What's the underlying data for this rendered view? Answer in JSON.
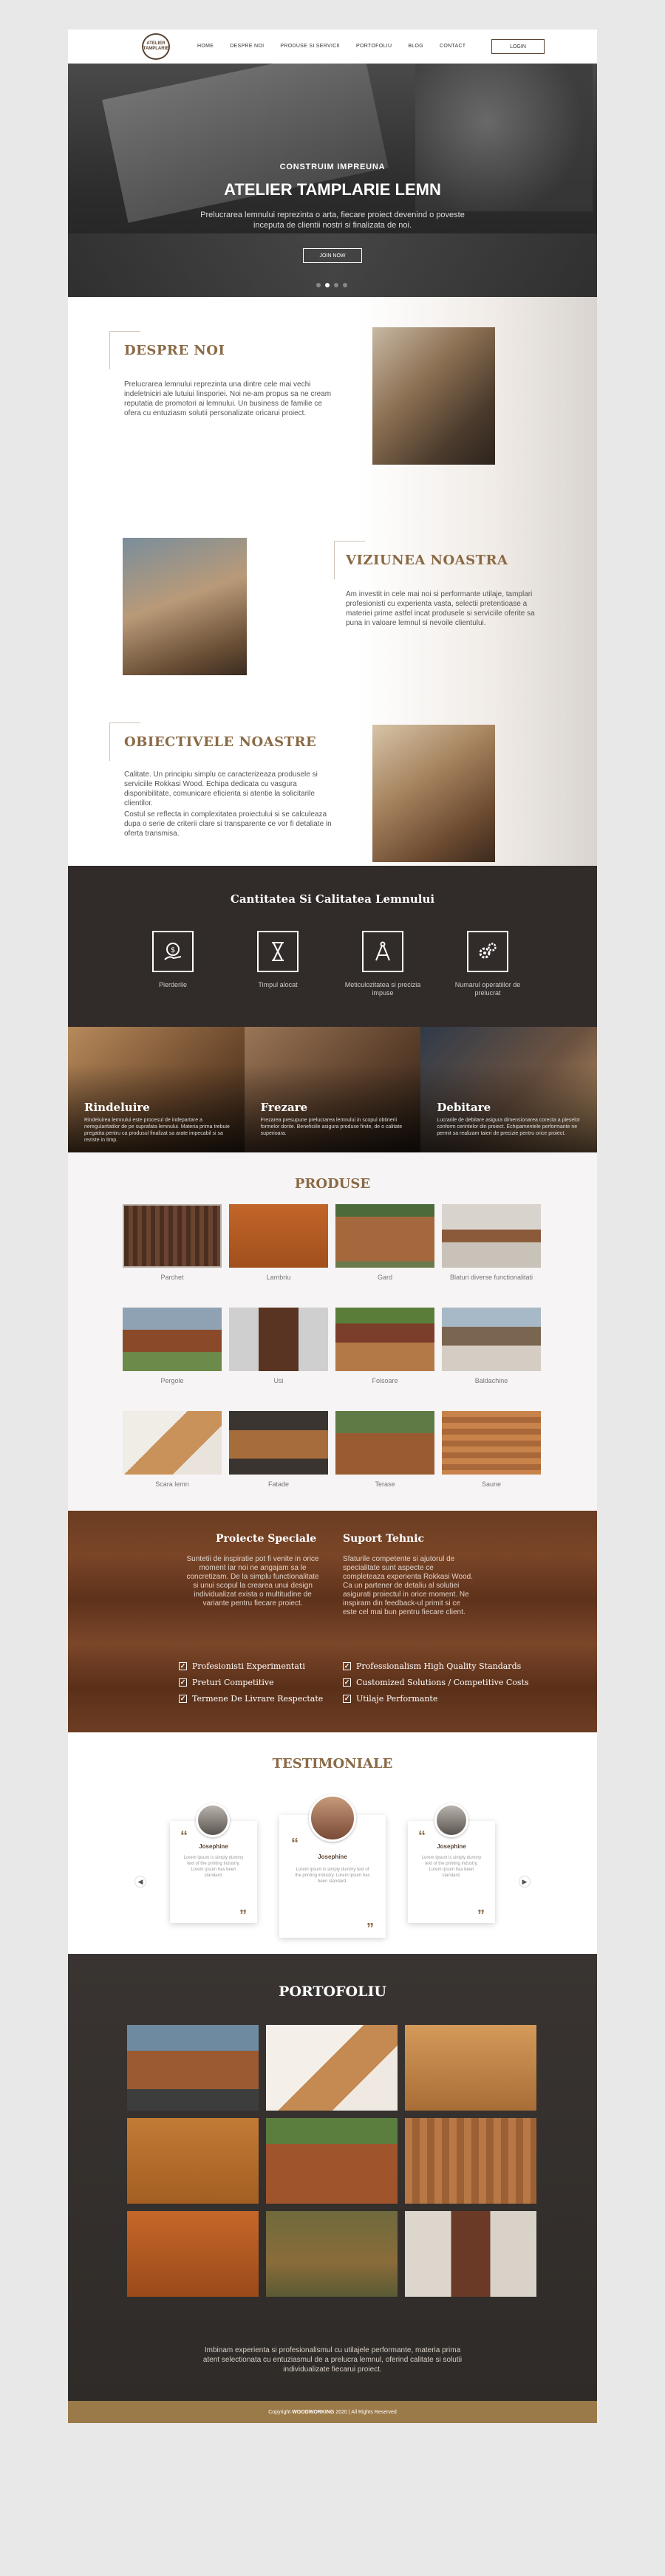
{
  "header": {
    "logo_text": "ATELIER TAMPLARIE",
    "nav": [
      "HOME",
      "DESPRE NOI",
      "PRODUSE SI SERVICII",
      "PORTOFOLIU",
      "BLOG",
      "CONTACT"
    ],
    "login_label": "LOGIN"
  },
  "hero": {
    "subtitle": "CONSTRUIM IMPREUNA",
    "title": "ATELIER TAMPLARIE LEMN",
    "description": "Prelucrarea lemnului reprezinta o arta, fiecare proiect devenind o poveste inceputa de clientii nostri si finalizata de noi.",
    "button_label": "JOIN NOW"
  },
  "about": {
    "despre_title": "DESPRE NOI",
    "despre_text": "Prelucrarea lemnului reprezinta una dintre cele mai vechi indeletniciri ale lutuiui linsporiei. Noi ne-am propus sa ne cream reputatia de promotori ai lemnului. Un business de familie ce ofera cu entuziasm solutii personalizate oricarui proiect.",
    "viziunea_title": "VIZIUNEA NOASTRA",
    "viziunea_text": "Am investit in cele mai noi si performante utilaje, tamplari profesionisti cu experienta vasta, selectii pretentioase a materiei prime astfel incat produsele si serviciile oferite sa puna in valoare lemnul si nevoile clientului.",
    "obiectivele_title": "OBIECTIVELE NOASTRE",
    "obiectivele_text1": "Calitate. Un principiu simplu ce caracterizeaza produsele si serviciile Rokkasi Wood. Echipa dedicata cu vasgura disponibilitate, comunicare eficienta si atentie la solicitarile clientilor.",
    "obiectivele_text2": "Costul se reflecta in complexitatea proiectului si se calculeaza dupa o serie de criterii clare si transparente ce vor fi detaliate in oferta transmisa."
  },
  "quality": {
    "title": "Cantitatea Si Calitatea Lemnului",
    "items": [
      {
        "icon": "money-icon",
        "label": "Pierderile"
      },
      {
        "icon": "hourglass-icon",
        "label": "Timpul alocat"
      },
      {
        "icon": "compass-icon",
        "label": "Meticulozitatea si precizia impuse"
      },
      {
        "icon": "gears-icon",
        "label": "Numarul operatiilor de prelucrat"
      }
    ]
  },
  "services": [
    {
      "title": "Rindeluire",
      "text": "Rindeluirea lemnului este procesul de indepartare a neregularitatilor de pe suprafata lemnului. Materia prima trebuie pregatita pentru ca produsul finalizat sa arate impecabil si sa reziste in timp."
    },
    {
      "title": "Frezare",
      "text": "Frezarea presupune prelucrarea lemnului in scopul obtinerii formelor dorite. Beneficiile asigura produse finite, de o calitate superioara."
    },
    {
      "title": "Debitare",
      "text": "Lucrarile de debitare asigura dimensionarea corecta a pieselor conform cerintelor din proiect. Echipamentele performante ne permit sa realizam taieri de precizie pentru orice proiect."
    }
  ],
  "products": {
    "title": "PRODUSE",
    "items": [
      "Parchet",
      "Lambriu",
      "Gard",
      "Blaturi diverse functionalitati",
      "Pergole",
      "Usi",
      "Foisoare",
      "Baldachine",
      "Scara lemn",
      "Fatade",
      "Terase",
      "Saune"
    ]
  },
  "features": {
    "proiecte_title": "Proiecte Speciale",
    "proiecte_text": "Suntetii de inspiratie pot fi venite in orice moment iar noi ne angajam sa le concretizam. De la simplu functionalitate si unui scopul la crearea unui design individualizat exista o multitudine de variante pentru fiecare proiect.",
    "suport_title": "Suport Tehnic",
    "suport_text": "Sfaturile competente si ajutorul de specialitate sunt aspecte ce completeaza experienta Rokkasi Wood. Ca un partener de detaliu al solutiei asigurati proiectul in orice moment. Ne inspiram din feedback-ul primit si ce este cel mai bun pentru fiecare client.",
    "checks_left": [
      "Profesionisti Experimentati",
      "Preturi Competitive",
      "Termene De Livrare Respectate"
    ],
    "checks_right": [
      "Professionalism High Quality Standards",
      "Customized Solutions / Competitive Costs",
      "Utilaje Performante"
    ]
  },
  "testimonials": {
    "title": "TESTIMONIALE",
    "cards": [
      {
        "name": "Josephine",
        "text": "Lorem ipsum is simply dummy text of the printing industry. Lorem ipsum has been standard."
      },
      {
        "name": "Josephine",
        "text": "Lorem ipsum is simply dummy text of the printing industry. Lorem ipsum has been standard."
      },
      {
        "name": "Josephine",
        "text": "Lorem ipsum is simply dummy text of the printing industry. Lorem ipsum has been standard."
      }
    ]
  },
  "portfolio": {
    "title": "PORTOFOLIU",
    "description": "Imbinam experienta si profesionalismul cu utilajele performante, materia prima atent selectionata cu entuziasmul de a prelucra lemnul, oferind calitate si solutii individualizate fiecarui proiect."
  },
  "footer": {
    "prefix": "Copyright",
    "brand": "WOODWORKING",
    "suffix": "2020 | All Rights Reserved"
  }
}
